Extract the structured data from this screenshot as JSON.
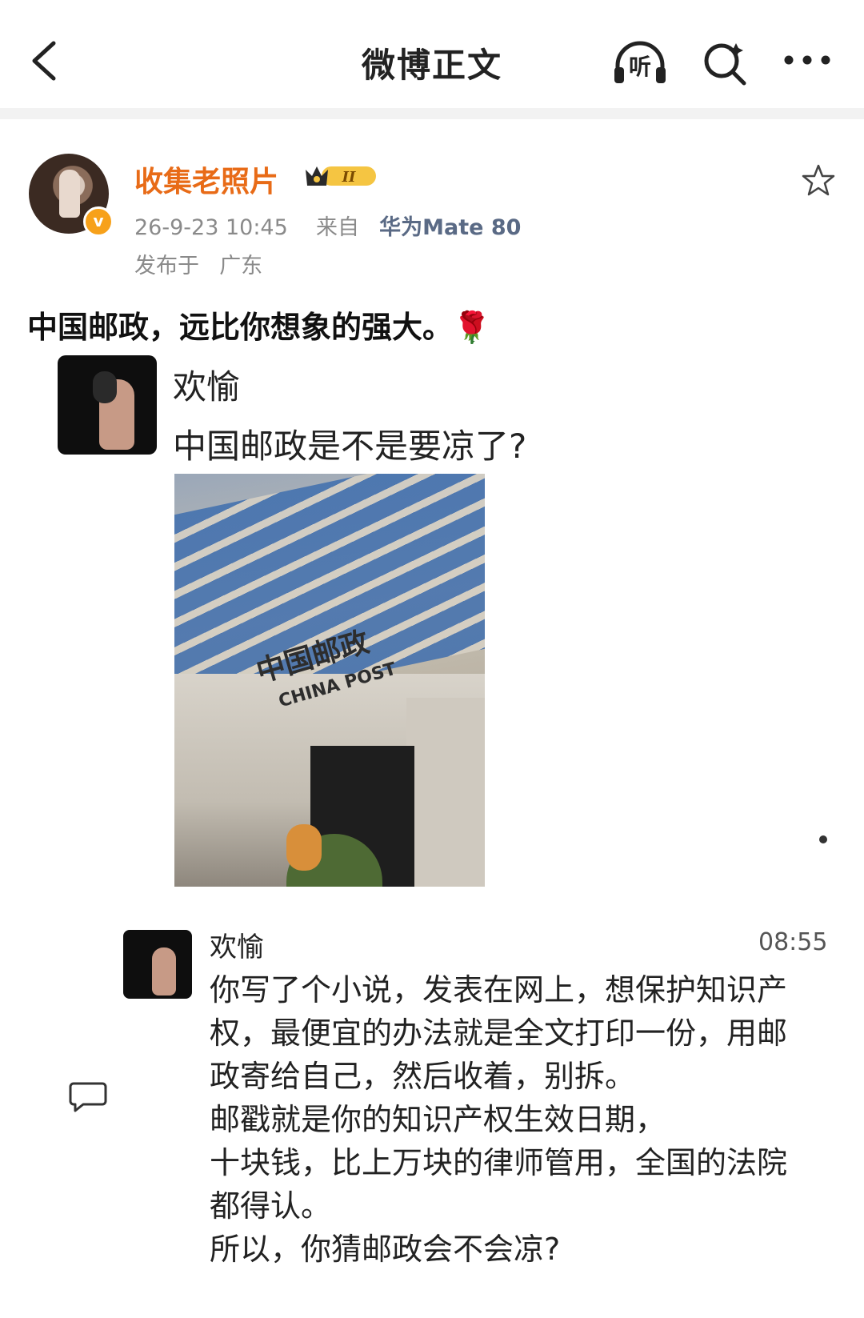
{
  "header": {
    "title": "微博正文",
    "listen_label": "听"
  },
  "post": {
    "author": "收集老照片",
    "vip_level": "II",
    "verified_mark": "v",
    "time": "26-9-23 10:45",
    "source_prefix": "来自",
    "device": "华为Mate 80",
    "location_prefix": "发布于",
    "location": "广东",
    "text": "中国邮政，远比你想象的强大。🌹"
  },
  "chat": {
    "first_sender": "欢愉",
    "first_message": "中国邮政是不是要凉了?",
    "photo_sign_cn": "中国邮政",
    "photo_sign_en": "CHINA POST",
    "reply_sender": "欢愉",
    "reply_time": "08:55",
    "reply_lines": [
      "你写了个小说，发表在网上，想保护知识产",
      "权，最便宜的办法就是全文打印一份，用邮",
      "政寄给自己，然后收着，别拆。",
      "邮戳就是你的知识产权生效日期，",
      "十块钱，比上万块的律师管用，全国的法院",
      "都得认。",
      "所以，你猜邮政会不会凉?"
    ]
  },
  "colors": {
    "author": "#e86b17",
    "device": "#5a6a85",
    "meta": "#8a8a8a",
    "badge": "#f7a11a"
  },
  "icons": [
    "back-icon",
    "headphones-icon",
    "search-icon",
    "more-icon",
    "star-icon",
    "comment-icon"
  ]
}
